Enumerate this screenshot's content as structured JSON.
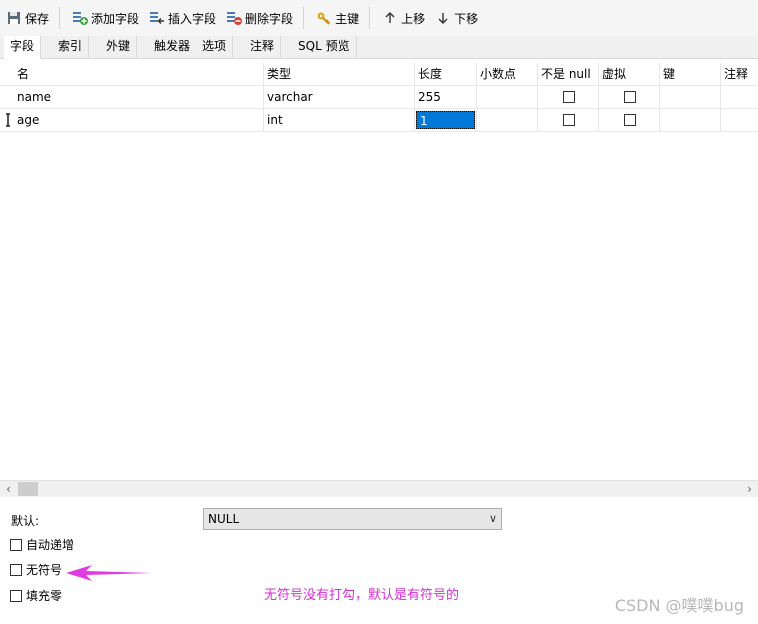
{
  "toolbar": {
    "save": "保存",
    "add_field": "添加字段",
    "insert_field": "插入字段",
    "delete_field": "删除字段",
    "primary_key": "主键",
    "move_up": "上移",
    "move_down": "下移"
  },
  "tabs": [
    "字段",
    "索引",
    "外键",
    "触发器",
    "选项",
    "注释",
    "SQL 预览"
  ],
  "columns": [
    "名",
    "类型",
    "长度",
    "小数点",
    "不是 null",
    "虚拟",
    "键",
    "注释"
  ],
  "rows": [
    {
      "name": "name",
      "type": "varchar",
      "length": "255",
      "decimals": "",
      "not_null": false,
      "virtual": false,
      "key": "",
      "comment": ""
    },
    {
      "name": "age",
      "type": "int",
      "length": "1",
      "decimals": "",
      "not_null": false,
      "virtual": false,
      "key": "",
      "comment": ""
    }
  ],
  "properties": {
    "default_label": "默认:",
    "default_value": "NULL",
    "auto_increment": "自动递增",
    "unsigned": "无符号",
    "zerofill": "填充零"
  },
  "annotation": "无符号没有打勾，默认是有符号的",
  "watermark": "CSDN @噗噗bug",
  "colors": {
    "selection": "#0078d7",
    "annotation": "#d42fd3"
  }
}
